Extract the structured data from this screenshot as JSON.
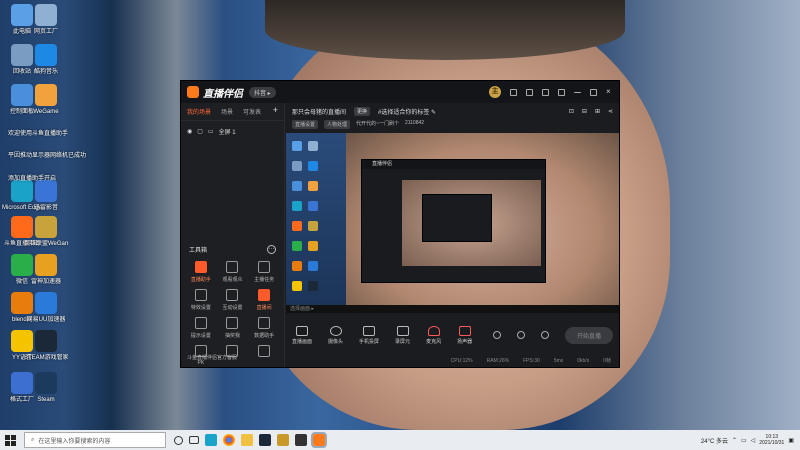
{
  "desktop": {
    "icons": [
      {
        "label": "此电脑",
        "color": "#5aa0e6"
      },
      {
        "label": "网页工厂",
        "color": "#8fb0d0"
      },
      {
        "label": "回收站",
        "color": "#7a9cc2"
      },
      {
        "label": "酷狗音乐",
        "color": "#1e88e5"
      },
      {
        "label": "控制面板",
        "color": "#4a8fd9"
      },
      {
        "label": "WeGame",
        "color": "#f2a23c"
      },
      {
        "label": "Microsoft Edge",
        "color": "#1aa2c8"
      },
      {
        "label": "迅雷影音",
        "color": "#3a75d6"
      },
      {
        "label": "斗鱼直播伴侣",
        "color": "#ff6a1a"
      },
      {
        "label": "英雄联盟WeGame版",
        "color": "#c8a23a"
      },
      {
        "label": "微信",
        "color": "#2aae4a"
      },
      {
        "label": "雷神加速器",
        "color": "#e8a020"
      },
      {
        "label": "blender",
        "color": "#e87d0d"
      },
      {
        "label": "网易UU加速器",
        "color": "#2a7ad9"
      },
      {
        "label": "YY语音",
        "color": "#f5c400"
      },
      {
        "label": "STEAM游戏管家",
        "color": "#1b2838"
      },
      {
        "label": "格式工厂",
        "color": "#3c6fd0"
      },
      {
        "label": "Steam",
        "color": "#1b3a5e"
      }
    ],
    "notes": [
      "欢迎使用斗鱼直播助手",
      "平因推动显示器网络机已成功",
      "添加直播助手开启"
    ]
  },
  "app": {
    "brand": "直播伴侣",
    "version_badge": "抖音 ▸",
    "coin": "主",
    "left_tabs": [
      "我的场景",
      "场景",
      "可发表"
    ],
    "plus": "+",
    "scene_label": "全屏 1",
    "tools_header": "工具箱",
    "tools": [
      {
        "label": "直播助手",
        "hl": true
      },
      {
        "label": "观看观众",
        "hl": false
      },
      {
        "label": "主播任务",
        "hl": false
      },
      {
        "label": "特效设置",
        "hl": false
      },
      {
        "label": "互动设置",
        "hl": false
      },
      {
        "label": "直播间",
        "hl": true
      },
      {
        "label": "提示设置",
        "hl": false
      },
      {
        "label": "抽奖我",
        "hl": false
      },
      {
        "label": "数据助手",
        "hl": false
      },
      {
        "label": "PK",
        "hl": false
      },
      {
        "label": "",
        "hl": false
      },
      {
        "label": "",
        "hl": false
      }
    ],
    "tip": "斗鱼直播伴侣官方客服",
    "topinfo": {
      "title": "那只会母猪的直播间",
      "tag1": "更换",
      "tag2": "#选择适合你的标签 ✎"
    },
    "subinfo": [
      "直播设置",
      "人物处理",
      "代开代的~一门刷个",
      "2110842"
    ],
    "preview_bar": "选择画面 ▸",
    "controls": [
      "直播画面",
      "摄像头",
      "手机投屏",
      "录屏元",
      "麦克风",
      "扬声器"
    ],
    "start_label": "开始直播",
    "status": [
      "CPU:12%",
      "RAM:26%",
      "FPS:30",
      "5ms",
      "0kb/s",
      "0帧"
    ]
  },
  "taskbar": {
    "search_placeholder": "在这里输入你要搜索的内容",
    "weather": "24°C 多云",
    "time": "10:13",
    "date": "2021/10/31"
  }
}
